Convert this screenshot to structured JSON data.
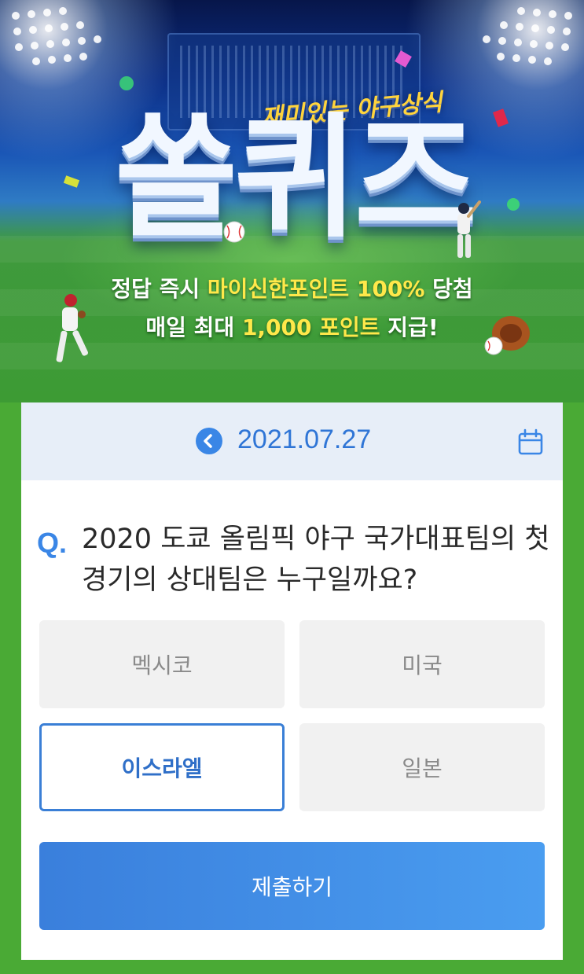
{
  "banner": {
    "tagline": "재미있는 야구상식",
    "logo": "쏠퀴즈",
    "prize_line1_prefix": "정답 즉시 ",
    "prize_line1_highlight": "마이신한포인트 100%",
    "prize_line1_suffix": " 당첨",
    "prize_line2_prefix": "매일 최대 ",
    "prize_line2_highlight": "1,000 포인트",
    "prize_line2_suffix": " 지급!"
  },
  "date_nav": {
    "date": "2021.07.27",
    "prev_icon": "chevron-left-icon",
    "calendar_icon": "calendar-icon"
  },
  "question": {
    "marker": "Q.",
    "text": "2020 도쿄 올림픽 야구 국가대표팀의 첫 경기의 상대팀은 누구일까요?"
  },
  "options": [
    {
      "label": "멕시코",
      "selected": false
    },
    {
      "label": "미국",
      "selected": false
    },
    {
      "label": "이스라엘",
      "selected": true
    },
    {
      "label": "일본",
      "selected": false
    }
  ],
  "submit_label": "제출하기",
  "colors": {
    "accent_blue": "#3a86e6",
    "frame_green": "#4aaa35",
    "highlight_yellow": "#ffe84a"
  }
}
